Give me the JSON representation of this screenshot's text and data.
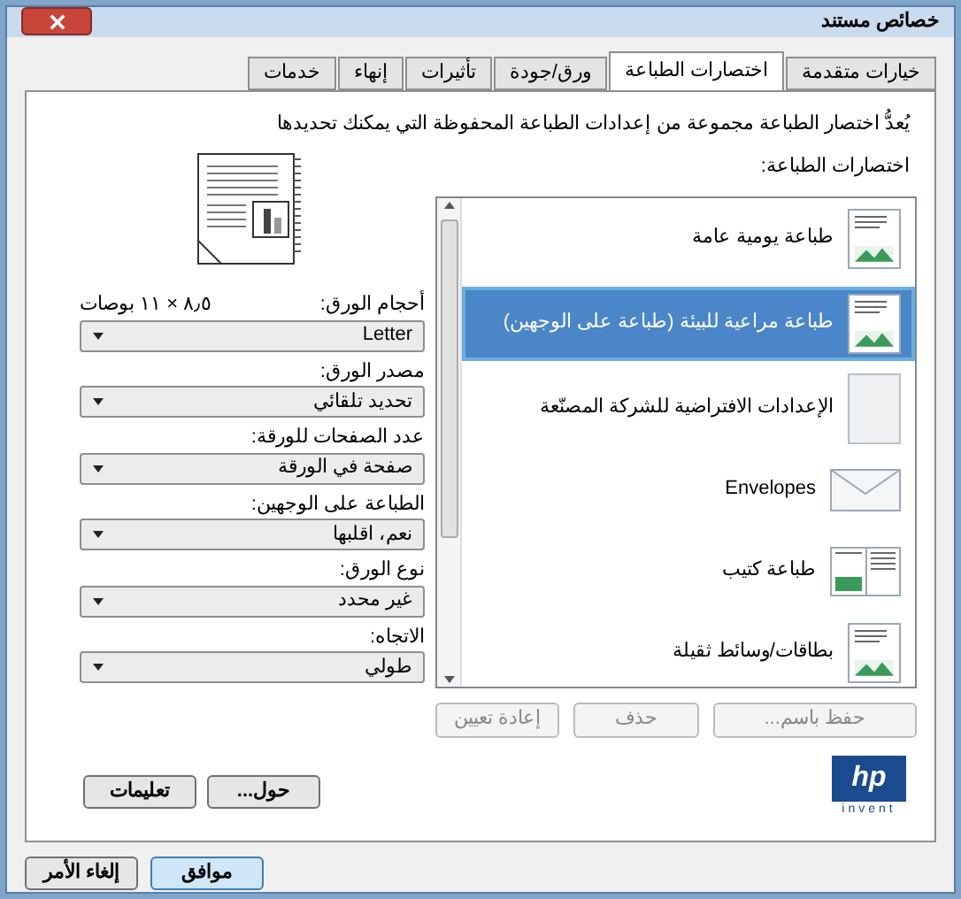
{
  "window": {
    "title": "خصائص مستند"
  },
  "tabs": [
    {
      "label": "خيارات متقدمة",
      "selected": false
    },
    {
      "label": "اختصارات الطباعة",
      "selected": true
    },
    {
      "label": "ورق/جودة",
      "selected": false
    },
    {
      "label": "تأثيرات",
      "selected": false
    },
    {
      "label": "إنهاء",
      "selected": false
    },
    {
      "label": "خدمات",
      "selected": false
    }
  ],
  "description": "يُعدُّ اختصار الطباعة مجموعة من إعدادات الطباعة المحفوظة التي يمكنك تحديدها",
  "shortcuts_label": "اختصارات الطباعة:",
  "shortcuts": [
    {
      "kind": "doc",
      "label": "طباعة يومية عامة",
      "selected": false
    },
    {
      "kind": "duplex",
      "label": "طباعة مراعية للبيئة (طباعة على الوجهين)",
      "selected": true
    },
    {
      "kind": "blank",
      "label": "الإعدادات الافتراضية للشركة المصنّعة",
      "selected": false
    },
    {
      "kind": "envelope",
      "label": "Envelopes",
      "selected": false
    },
    {
      "kind": "booklet",
      "label": "طباعة كتيب",
      "selected": false
    },
    {
      "kind": "card",
      "label": "بطاقات/وسائط ثقيلة",
      "selected": false
    }
  ],
  "shortcut_buttons": [
    {
      "label": "حفظ باسم...",
      "disabled": true
    },
    {
      "label": "حذف",
      "disabled": true
    },
    {
      "label": "إعادة تعيين",
      "disabled": true
    }
  ],
  "settings": [
    {
      "label": "أحجام الورق:",
      "note": "٨٫٥ × ١١ بوصات",
      "value": "Letter"
    },
    {
      "label": "مصدر الورق:",
      "value": "تحديد تلقائي"
    },
    {
      "label": "عدد الصفحات للورقة:",
      "value": "صفحة في الورقة"
    },
    {
      "label": "الطباعة على الوجهين:",
      "value": "نعم، اقلبها"
    },
    {
      "label": "نوع الورق:",
      "value": "غير محدد"
    },
    {
      "label": "الاتجاه:",
      "value": "طولي"
    }
  ],
  "logo": {
    "mark": "hp",
    "tagline": "invent"
  },
  "panel_buttons": [
    "حول...",
    "تعليمات"
  ],
  "dialog_buttons": [
    {
      "label": "موافق",
      "default": true
    },
    {
      "label": "إلغاء الأمر",
      "default": false
    }
  ]
}
